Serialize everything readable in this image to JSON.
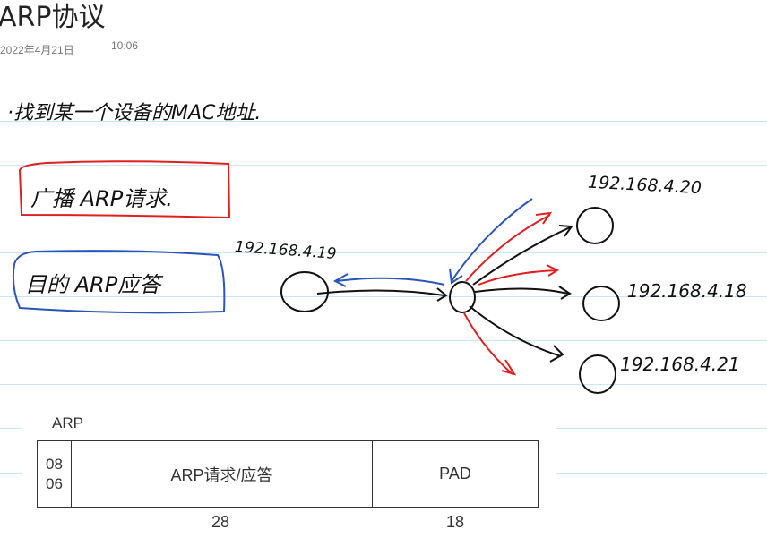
{
  "page": {
    "title": "ARP协议",
    "date": "2022年4月21日",
    "time": "10:06"
  },
  "notes": {
    "line1": "·找到某一个设备的MAC地址.",
    "broadcast_box": "广播 ARP请求.",
    "reply_box": "目的 ARP应答",
    "colors": {
      "broadcast": "#e02020",
      "reply": "#2a55b8",
      "ink": "#111111"
    }
  },
  "diagram": {
    "source_ip": "192.168.4.19",
    "targets": [
      "192.168.4.20",
      "192.168.4.18",
      "192.168.4.21"
    ]
  },
  "arp_frame": {
    "label": "ARP",
    "type_top": "08",
    "type_bottom": "06",
    "payload": "ARP请求/应答",
    "pad": "PAD",
    "payload_size": "28",
    "pad_size": "18"
  }
}
